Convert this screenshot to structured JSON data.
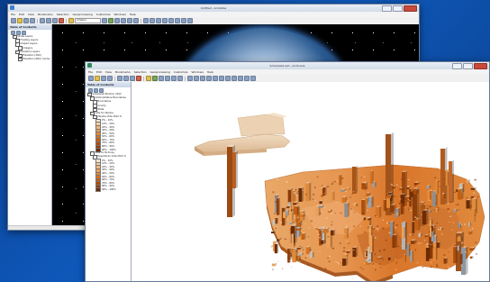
{
  "back_window": {
    "title": "Untitled - ArcGlobe",
    "menu": [
      "File",
      "Edit",
      "View",
      "Bookmarks",
      "Selection",
      "Geoprocessing",
      "Customize",
      "Windows",
      "Help"
    ],
    "scale": "0 Meters",
    "toc": {
      "title": "Table of Contents",
      "layers": [
        {
          "label": "Globe Layers",
          "indent": 1,
          "checked": true
        },
        {
          "label": "Floating Layers",
          "indent": 2,
          "checked": false
        },
        {
          "label": "Draped Layers",
          "indent": 2,
          "checked": true
        },
        {
          "label": "Imagery",
          "indent": 3,
          "checked": true
        },
        {
          "label": "Elevation Layers",
          "indent": 2,
          "checked": true
        },
        {
          "label": "Elevation (30m)",
          "indent": 3,
          "checked": true
        },
        {
          "label": "Elevation (90m) Cache",
          "indent": 3,
          "checked": true
        }
      ]
    }
  },
  "front_window": {
    "title": "Scheduled.sxd - ArcScene",
    "menu": [
      "File",
      "Edit",
      "View",
      "Bookmarks",
      "Selection",
      "Geoprocessing",
      "Customize",
      "Windows",
      "Help"
    ],
    "toc": {
      "title": "Table of Contents",
      "layers": [
        {
          "label": "Scheduled Election 2012",
          "indent": 0,
          "checked": true
        },
        {
          "label": "Administrative Boundaries",
          "indent": 1,
          "checked": true
        },
        {
          "label": "Boundaries",
          "indent": 2,
          "checked": false
        },
        {
          "label": "County",
          "indent": 2,
          "checked": false
        },
        {
          "label": "State",
          "indent": 2,
          "checked": false
        },
        {
          "label": "Vote for Obama",
          "indent": 1,
          "checked": true
        },
        {
          "label": "Obama Vote 2012 %",
          "indent": 2,
          "checked": false
        }
      ],
      "legend_obama": [
        "0% - 10%",
        "10% - 20%",
        "20% - 30%",
        "30% - 40%",
        "40% - 50%",
        "50% - 60%",
        "60% - 70%",
        "70% - 80%",
        "80% - 90%",
        "90% - 100%"
      ],
      "group2": [
        {
          "label": "Vote for Romney",
          "indent": 1,
          "checked": true
        },
        {
          "label": "Republican Vote 2012 %",
          "indent": 2,
          "checked": false
        }
      ],
      "legend_romney": [
        "0% - 10%",
        "10% - 20%",
        "20% - 30%",
        "30% - 40%",
        "40% - 50%",
        "50% - 60%",
        "60% - 70%",
        "70% - 80%",
        "80% - 90%",
        "90% - 100%"
      ],
      "colors": [
        "#fbe6cf",
        "#f7cfa4",
        "#f2b77a",
        "#eda156",
        "#e48a36",
        "#d7731f",
        "#c55f10",
        "#ad4c08",
        "#8f3b05",
        "#6e2b03"
      ]
    }
  }
}
